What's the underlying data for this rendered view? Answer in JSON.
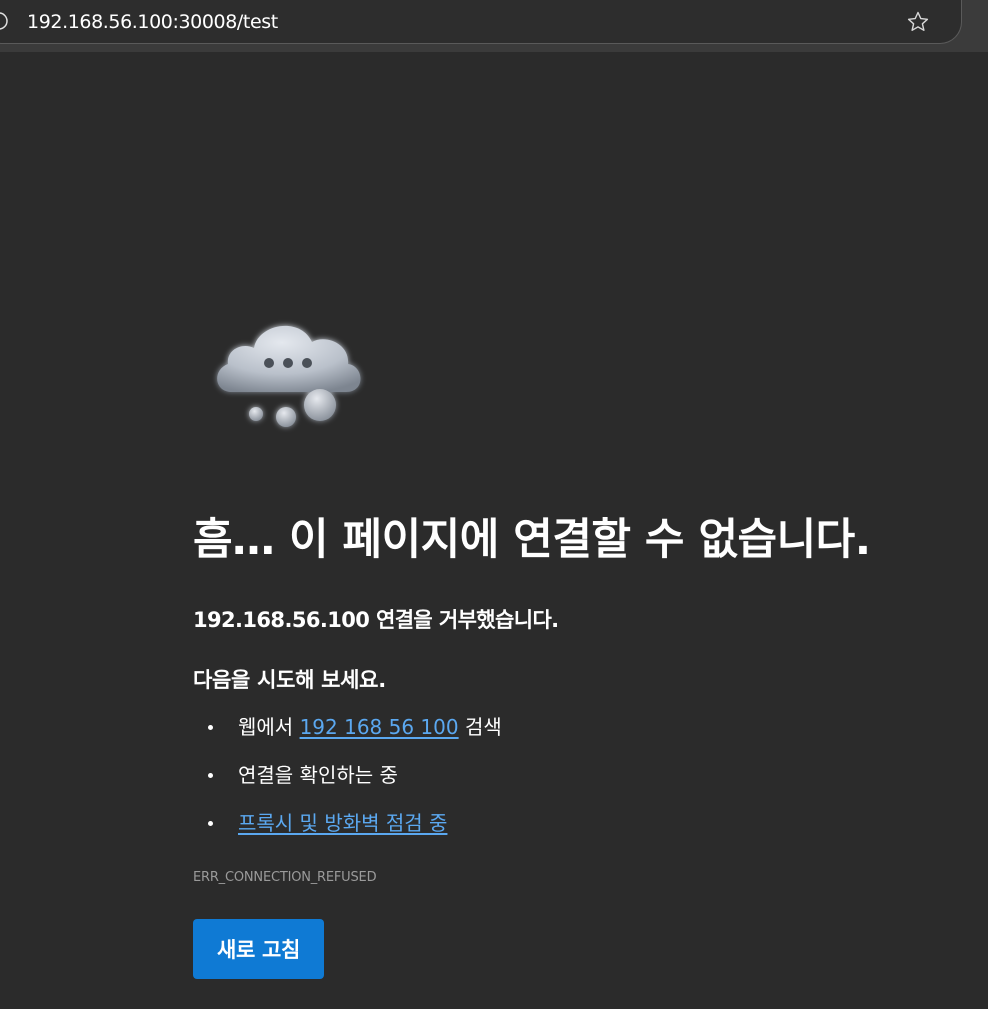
{
  "browser": {
    "url": "192.168.56.100:30008/test",
    "info_icon": "info-icon",
    "favorite_icon": "star-icon"
  },
  "error_page": {
    "illustration": "cloud-thinking-icon",
    "headline": "흠… 이 페이지에 연결할 수 없습니다.",
    "refused_message": "192.168.56.100 연결을 거부했습니다.",
    "try_title": "다음을 시도해 보세요.",
    "suggestions": [
      {
        "prefix": "웹에서 ",
        "link": "192 168 56 100",
        "suffix": " 검색"
      },
      {
        "text": "연결을 확인하는 중"
      },
      {
        "link": "프록시 및 방화벽 점검 중"
      }
    ],
    "error_code": "ERR_CONNECTION_REFUSED",
    "refresh_label": "새로 고침"
  },
  "colors": {
    "background": "#2b2b2b",
    "link": "#5ba8f0",
    "button": "#0f7ad4"
  }
}
